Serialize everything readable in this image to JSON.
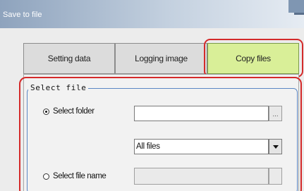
{
  "window": {
    "title": "Save to file"
  },
  "tabs": [
    {
      "label": "Setting data",
      "selected": false
    },
    {
      "label": "Logging image",
      "selected": false
    },
    {
      "label": "Copy files",
      "selected": true
    }
  ],
  "select_file": {
    "legend": "Select file",
    "select_folder": {
      "label": "Select folder",
      "checked": true,
      "value": "",
      "browse_label": "..."
    },
    "filter": {
      "selected": "All files"
    },
    "select_file_name": {
      "label": "Select file name",
      "checked": false,
      "value": ""
    }
  },
  "colors": {
    "active_tab": "#d9ef98",
    "highlight": "#d42a2a",
    "group_border": "#5a86c4",
    "title_bar": "#8ea3bd"
  }
}
